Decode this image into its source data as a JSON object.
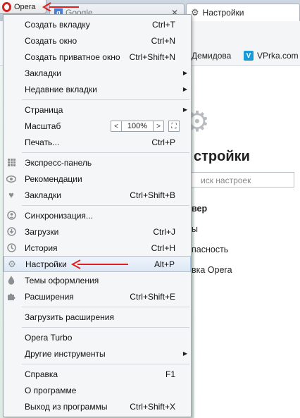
{
  "opera_button": {
    "label": "Opera"
  },
  "tabs": [
    {
      "title": "Google",
      "icon": "google-icon"
    },
    {
      "title": "Настройки",
      "icon": "gear-icon"
    }
  ],
  "bookmarks": [
    {
      "label": "Демидова"
    },
    {
      "label": "VPrka.com",
      "icon": "vimeo-icon"
    }
  ],
  "page": {
    "heading": "стройки",
    "search_placeholder": "иск настроек",
    "links": [
      "вер",
      "ы",
      "пасность",
      "вка Opera"
    ]
  },
  "menu": {
    "zoom_value": "100%",
    "items": [
      {
        "label": "Создать вкладку",
        "shortcut": "Ctrl+T"
      },
      {
        "label": "Создать окно",
        "shortcut": "Ctrl+N"
      },
      {
        "label": "Создать приватное окно",
        "shortcut": "Ctrl+Shift+N"
      },
      {
        "label": "Закладки",
        "submenu": true
      },
      {
        "label": "Недавние вкладки",
        "submenu": true
      },
      {
        "label": "Страница",
        "submenu": true
      },
      {
        "label": "Масштаб"
      },
      {
        "label": "Печать...",
        "shortcut": "Ctrl+P"
      },
      {
        "label": "Экспресс-панель",
        "icon": "grid-icon"
      },
      {
        "label": "Рекомендации",
        "icon": "eye-icon"
      },
      {
        "label": "Закладки",
        "shortcut": "Ctrl+Shift+B",
        "icon": "heart-icon"
      },
      {
        "label": "Синхронизация...",
        "icon": "sync-icon"
      },
      {
        "label": "Загрузки",
        "shortcut": "Ctrl+J",
        "icon": "download-icon"
      },
      {
        "label": "История",
        "shortcut": "Ctrl+H",
        "icon": "clock-icon"
      },
      {
        "label": "Настройки",
        "shortcut": "Alt+P",
        "icon": "gear-icon"
      },
      {
        "label": "Темы оформления",
        "icon": "drop-icon"
      },
      {
        "label": "Расширения",
        "shortcut": "Ctrl+Shift+E",
        "icon": "puzzle-icon"
      },
      {
        "label": "Загрузить расширения"
      },
      {
        "label": "Opera Turbo"
      },
      {
        "label": "Другие инструменты",
        "submenu": true
      },
      {
        "label": "Справка",
        "shortcut": "F1"
      },
      {
        "label": "О программе"
      },
      {
        "label": "Выход из программы",
        "shortcut": "Ctrl+Shift+X"
      }
    ]
  },
  "colors": {
    "accent_red": "#e02020",
    "highlight": "#dde8f5"
  }
}
